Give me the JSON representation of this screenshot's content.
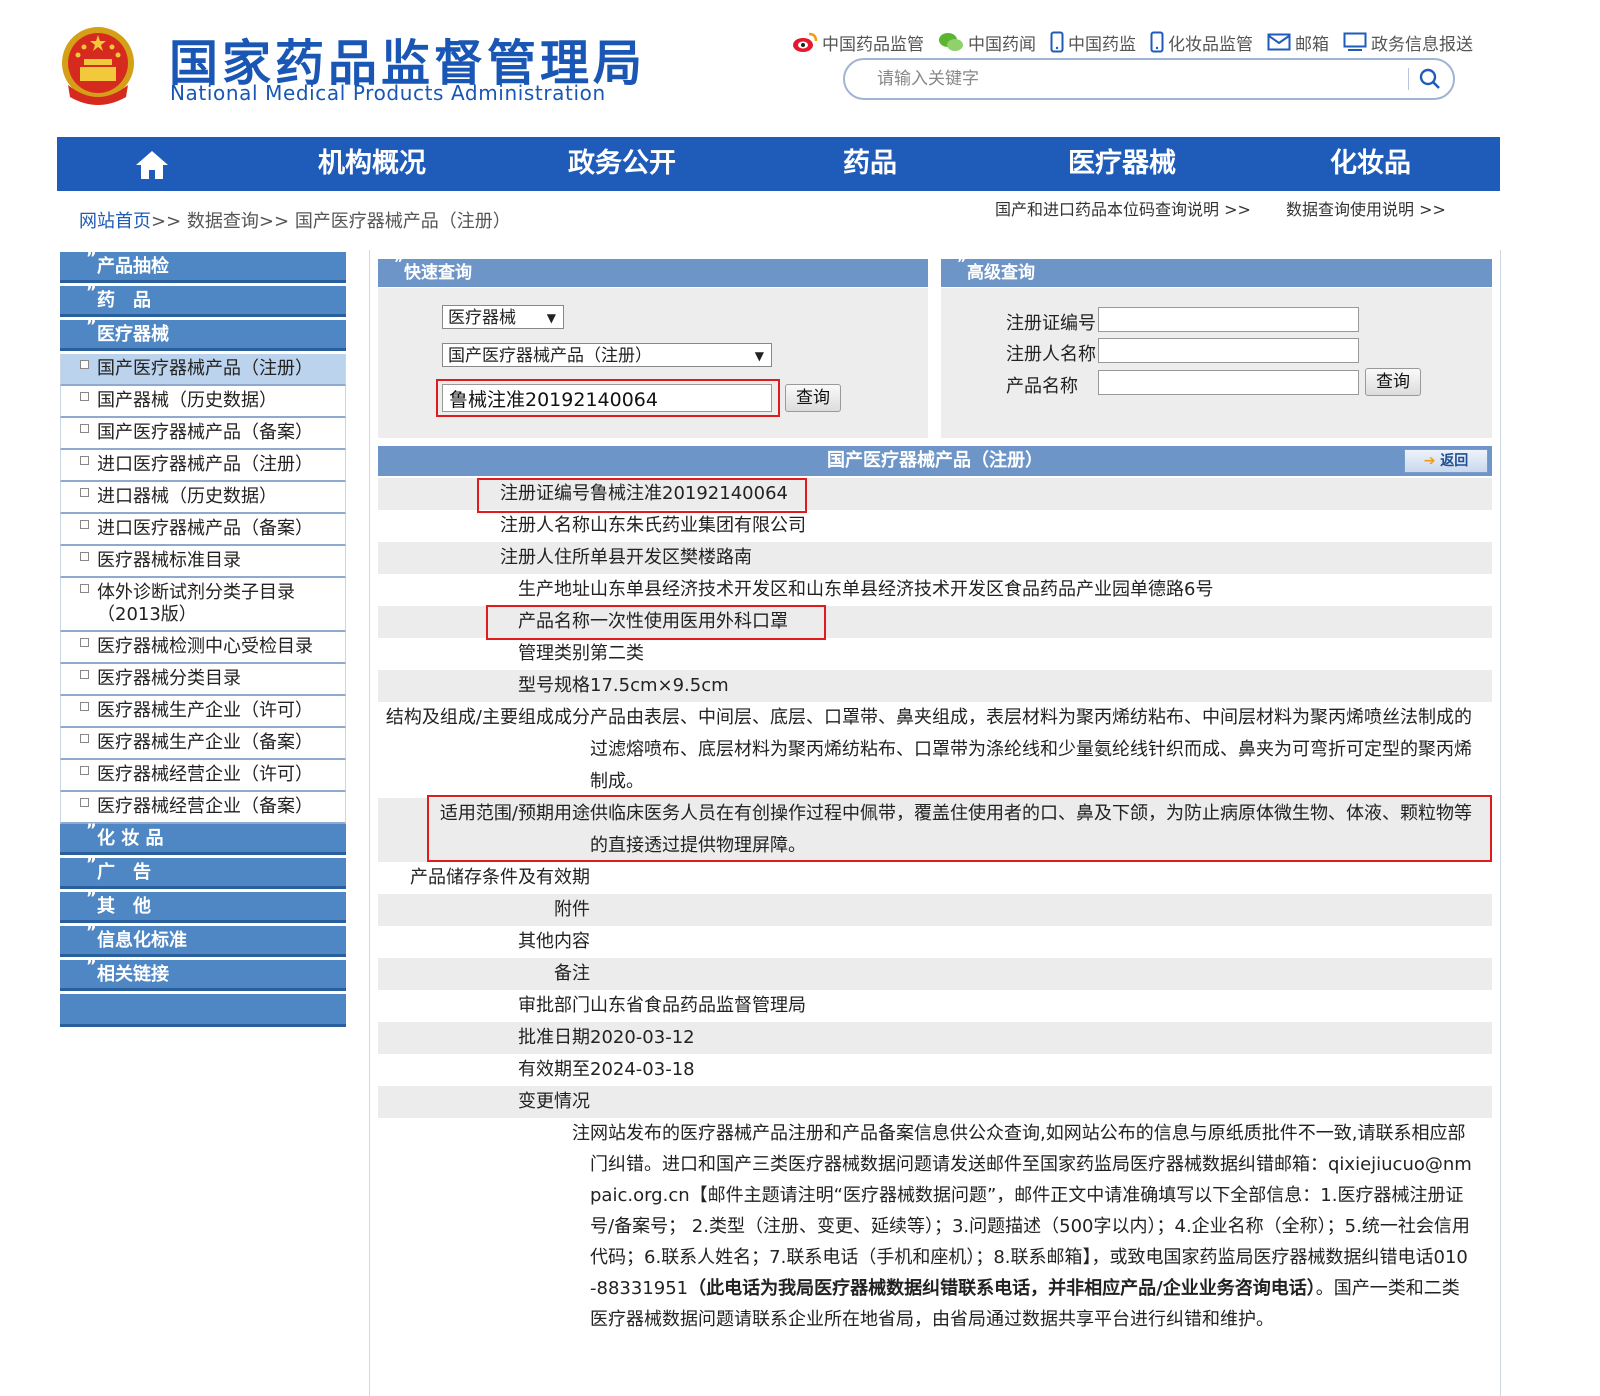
{
  "header": {
    "title_cn": "国家药品监督管理局",
    "title_en": "National Medical Products Administration",
    "links": [
      {
        "label": "中国药品监管",
        "icon": "weibo-icon"
      },
      {
        "label": "中国药闻",
        "icon": "wechat-icon"
      },
      {
        "label": "中国药监",
        "icon": "mobile-icon"
      },
      {
        "label": "化妆品监管",
        "icon": "mobile-icon"
      },
      {
        "label": "邮箱",
        "icon": "mail-icon"
      },
      {
        "label": "政务信息报送",
        "icon": "monitor-icon"
      }
    ],
    "search_placeholder": "请输入关键字"
  },
  "nav": {
    "items": [
      "机构概况",
      "政务公开",
      "药品",
      "医疗器械",
      "化妆品"
    ]
  },
  "breadcrumb": {
    "home": "网站首页",
    "sep": ">>",
    "level2": "数据查询",
    "level3": "国产医疗器械产品（注册）"
  },
  "help_links": [
    "国产和进口药品本位码查询说明 >>",
    "数据查询使用说明 >>"
  ],
  "sidebar": {
    "cat_products": "产品抽检",
    "cat_drugs": "药　品",
    "cat_devices": "医疗器械",
    "items": [
      "国产医疗器械产品（注册）",
      "国产器械（历史数据）",
      "国产医疗器械产品（备案）",
      "进口医疗器械产品（注册）",
      "进口器械（历史数据）",
      "进口医疗器械产品（备案）",
      "医疗器械标准目录",
      "体外诊断试剂分类子目录（2013版）",
      "医疗器械检测中心受检目录",
      "医疗器械分类目录",
      "医疗器械生产企业（许可）",
      "医疗器械生产企业（备案）",
      "医疗器械经营企业（许可）",
      "医疗器械经营企业（备案）"
    ],
    "cat_cosmetics": "化 妆 品",
    "cat_ads": "广　告",
    "cat_other": "其　他",
    "cat_info": "信息化标准",
    "cat_links": "相关链接"
  },
  "quick": {
    "title": "快速查询",
    "select1": "医疗器械",
    "select2": "国产医疗器械产品（注册）",
    "input_value": "鲁械注准20192140064",
    "button": "查询"
  },
  "advanced": {
    "title": "高级查询",
    "label_reg": "注册证编号",
    "label_owner": "注册人名称",
    "label_product": "产品名称",
    "button": "查询"
  },
  "result": {
    "title": "国产医疗器械产品（注册）",
    "back": "返回",
    "rows": [
      {
        "k": "注册证编号",
        "v": "鲁械注准20192140064"
      },
      {
        "k": "注册人名称",
        "v": "山东朱氏药业集团有限公司"
      },
      {
        "k": "注册人住所",
        "v": "单县开发区樊楼路南"
      },
      {
        "k": "生产地址",
        "v": "山东单县经济技术开发区和山东单县经济技术开发区食品药品产业园单德路6号"
      },
      {
        "k": "产品名称",
        "v": "一次性使用医用外科口罩"
      },
      {
        "k": "管理类别",
        "v": "第二类"
      },
      {
        "k": "型号规格",
        "v": "17.5cm×9.5cm"
      },
      {
        "k": "结构及组成/主要组成成分",
        "v": "产品由表层、中间层、底层、口罩带、鼻夹组成，表层材料为聚丙烯纺粘布、中间层材料为聚丙烯喷丝法制成的过滤熔喷布、底层材料为聚丙烯纺粘布、口罩带为涤纶线和少量氨纶线针织而成、鼻夹为可弯折可定型的聚丙烯制成。"
      },
      {
        "k": "适用范围/预期用途",
        "v": "供临床医务人员在有创操作过程中佩带，覆盖住使用者的口、鼻及下颌，为防止病原体微生物、体液、颗粒物等的直接透过提供物理屏障。"
      },
      {
        "k": "产品储存条件及有效期",
        "v": ""
      },
      {
        "k": "附件",
        "v": ""
      },
      {
        "k": "其他内容",
        "v": ""
      },
      {
        "k": "备注",
        "v": ""
      },
      {
        "k": "审批部门",
        "v": "山东省食品药品监督管理局"
      },
      {
        "k": "批准日期",
        "v": "2020-03-12"
      },
      {
        "k": "有效期至",
        "v": "2024-03-18"
      },
      {
        "k": "变更情况",
        "v": ""
      }
    ],
    "note_key": "注",
    "note_part1": "网站发布的医疗器械产品注册和产品备案信息供公众查询,如网站公布的信息与原纸质批件不一致,请联系相应部门纠错。进口和国产三类医疗器械数据问题请发送邮件至国家药监局医疗器械数据纠错邮箱：qixiejiucuo@nmpaic.org.cn【邮件主题请注明“医疗器械数据问题”，邮件正文中请准确填写以下全部信息：1.医疗器械注册证号/备案号； 2.类型（注册、变更、延续等）；3.问题描述（500字以内）；4.企业名称（全称）；5.统一社会信用代码；6.联系人姓名；7.联系电话（手机和座机）；8.联系邮箱】，或致电国家药监局医疗器械数据纠错电话010-88331951",
    "note_bold": "（此电话为我局医疗器械数据纠错联系电话，并非相应产品/企业业务咨询电话）",
    "note_part2": "。国产一类和二类医疗器械数据问题请联系企业所在地省局，由省局通过数据共享平台进行纠错和维护。"
  },
  "colors": {
    "brand_blue": "#1f5bb8",
    "header_bar": "#6d95c7",
    "highlight_red": "#e01b1b"
  }
}
